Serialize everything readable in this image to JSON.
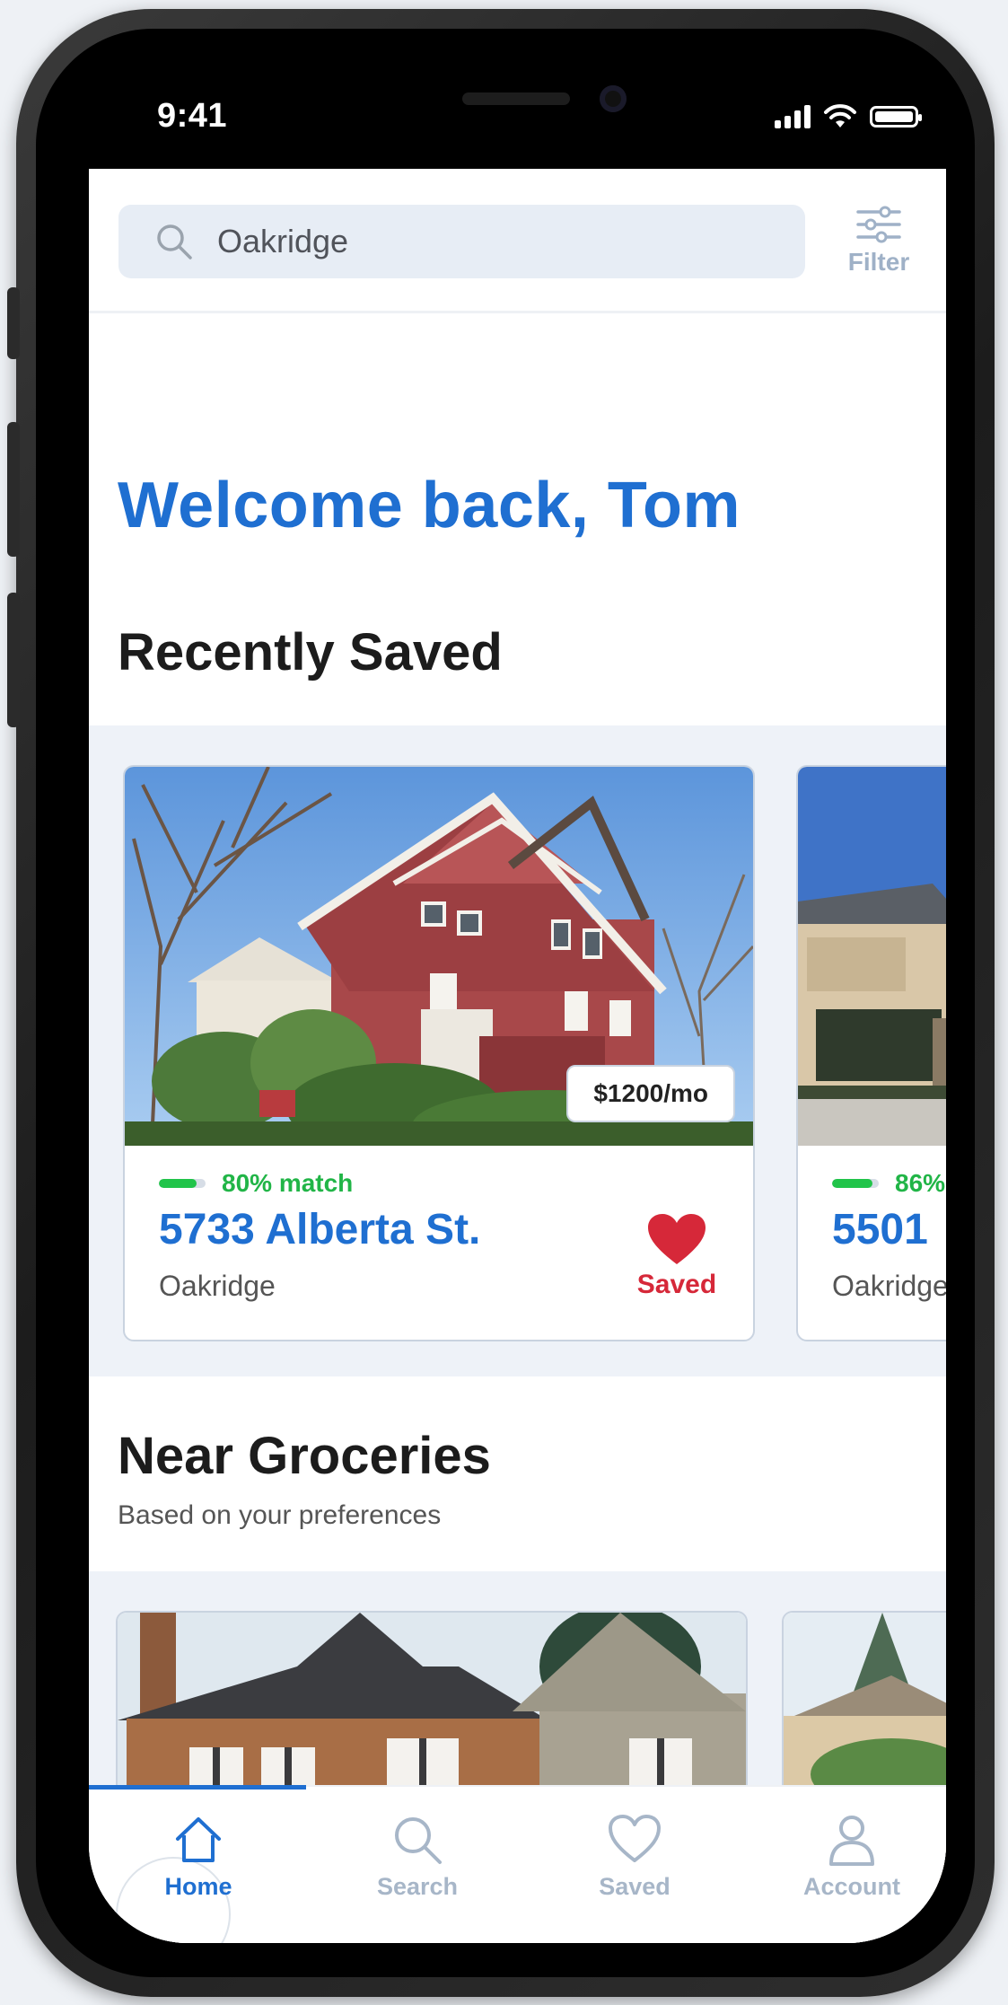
{
  "status_bar": {
    "time": "9:41"
  },
  "search": {
    "value": "Oakridge",
    "filter_label": "Filter"
  },
  "welcome": "Welcome back, Tom",
  "recently_saved": {
    "title": "Recently Saved",
    "cards": [
      {
        "price": "$1200/mo",
        "match_text": "80% match",
        "match_pct": 80,
        "address": "5733 Alberta St.",
        "neighborhood": "Oakridge",
        "saved_label": "Saved"
      },
      {
        "match_text": "86%",
        "match_pct": 86,
        "address": "5501",
        "neighborhood": "Oakridge"
      }
    ]
  },
  "near_groceries": {
    "title": "Near Groceries",
    "subtitle": "Based on your preferences"
  },
  "tabbar": {
    "active": "Home",
    "items": [
      {
        "label": "Home"
      },
      {
        "label": "Search"
      },
      {
        "label": "Saved"
      },
      {
        "label": "Account"
      }
    ]
  },
  "colors": {
    "brand_blue": "#1f6fd1",
    "match_green": "#21c44a",
    "saved_red": "#d62839",
    "inactive_gray": "#a7b6c8"
  }
}
